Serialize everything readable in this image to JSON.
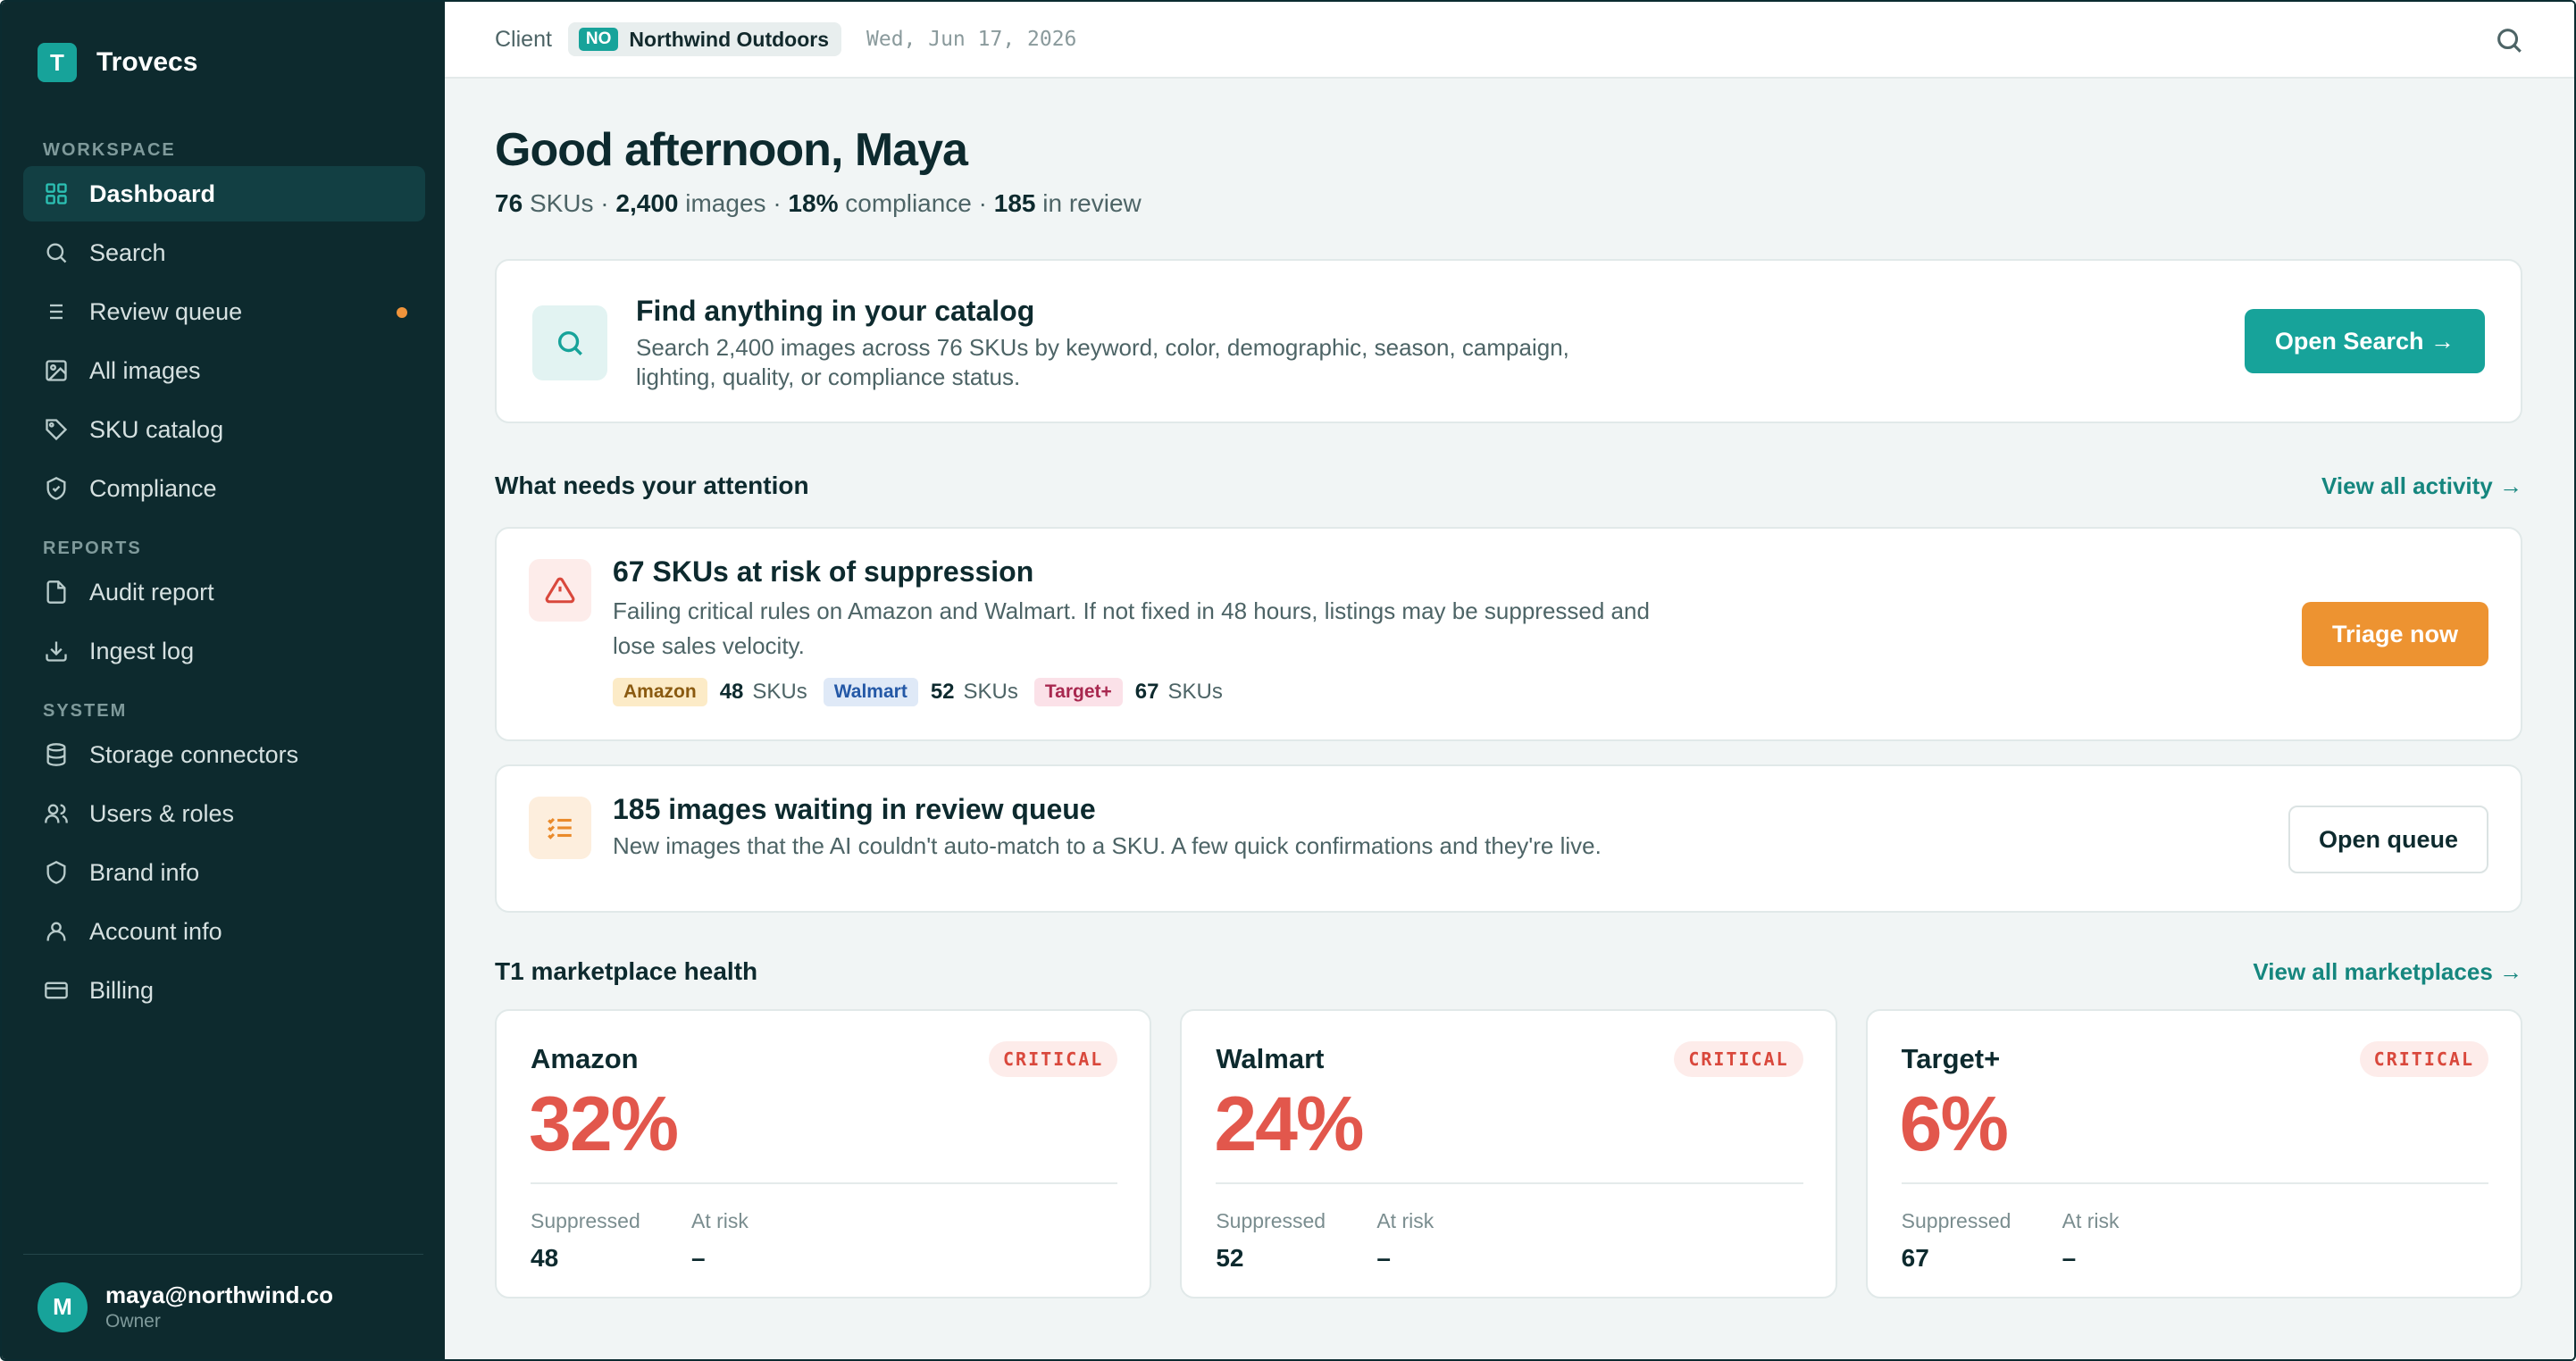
{
  "brand": {
    "logo_letter": "T",
    "name": "Trovecs"
  },
  "sidebar": {
    "sections": [
      {
        "label": "WORKSPACE",
        "items": [
          {
            "label": "Dashboard",
            "icon": "grid-icon",
            "active": true
          },
          {
            "label": "Search",
            "icon": "search-icon"
          },
          {
            "label": "Review queue",
            "icon": "list-icon",
            "dot": true
          },
          {
            "label": "All images",
            "icon": "image-icon"
          },
          {
            "label": "SKU catalog",
            "icon": "tag-icon"
          },
          {
            "label": "Compliance",
            "icon": "shield-check-icon"
          }
        ]
      },
      {
        "label": "REPORTS",
        "items": [
          {
            "label": "Audit report",
            "icon": "file-icon"
          },
          {
            "label": "Ingest log",
            "icon": "download-icon"
          }
        ]
      },
      {
        "label": "SYSTEM",
        "items": [
          {
            "label": "Storage connectors",
            "icon": "database-icon"
          },
          {
            "label": "Users & roles",
            "icon": "users-icon"
          },
          {
            "label": "Brand info",
            "icon": "shield-icon"
          },
          {
            "label": "Account info",
            "icon": "user-icon"
          },
          {
            "label": "Billing",
            "icon": "credit-card-icon"
          }
        ]
      }
    ],
    "user": {
      "initial": "M",
      "email": "maya@northwind.co",
      "role": "Owner"
    }
  },
  "topbar": {
    "client_label": "Client",
    "client_code": "NO",
    "client_name": "Northwind Outdoors",
    "date": "Wed, Jun 17, 2026"
  },
  "main": {
    "greeting": "Good afternoon, Maya",
    "stats": {
      "skus": "76",
      "skus_label": "SKUs",
      "images": "2,400",
      "images_label": "images",
      "compliance": "18%",
      "compliance_label": "compliance",
      "review": "185",
      "review_label": "in review",
      "sep": "·"
    },
    "search_card": {
      "title": "Find anything in your catalog",
      "desc": "Search 2,400 images across 76 SKUs by keyword, color, demographic, season, campaign, lighting, quality, or compliance status.",
      "button": "Open Search →"
    },
    "attention": {
      "title": "What needs your attention",
      "link": "View all activity →",
      "risk": {
        "title": "67 SKUs at risk of suppression",
        "desc": "Failing critical rules on Amazon and Walmart. If not fixed in 48 hours, listings may be suppressed and lose sales velocity.",
        "tags": [
          {
            "name": "Amazon",
            "count": "48",
            "unit": "SKUs",
            "style": "amazon"
          },
          {
            "name": "Walmart",
            "count": "52",
            "unit": "SKUs",
            "style": "walmart"
          },
          {
            "name": "Target+",
            "count": "67",
            "unit": "SKUs",
            "style": "target"
          }
        ],
        "button": "Triage now"
      },
      "queue": {
        "title": "185 images waiting in review queue",
        "desc": "New images that the AI couldn't auto-match to a SKU. A few quick confirmations and they're live.",
        "button": "Open queue"
      }
    },
    "health": {
      "title": "T1 marketplace health",
      "link": "View all marketplaces →",
      "cards": [
        {
          "name": "Amazon",
          "badge": "CRITICAL",
          "pct": "32%",
          "suppressed_label": "Suppressed",
          "suppressed": "48",
          "risk_label": "At risk",
          "risk": "–"
        },
        {
          "name": "Walmart",
          "badge": "CRITICAL",
          "pct": "24%",
          "suppressed_label": "Suppressed",
          "suppressed": "52",
          "risk_label": "At risk",
          "risk": "–"
        },
        {
          "name": "Target+",
          "badge": "CRITICAL",
          "pct": "6%",
          "suppressed_label": "Suppressed",
          "suppressed": "67",
          "risk_label": "At risk",
          "risk": "–"
        }
      ]
    }
  },
  "colors": {
    "accent": "#17a39a",
    "sidebar": "#0d2a2e",
    "critical": "#e2574c",
    "warning": "#ed9331"
  }
}
